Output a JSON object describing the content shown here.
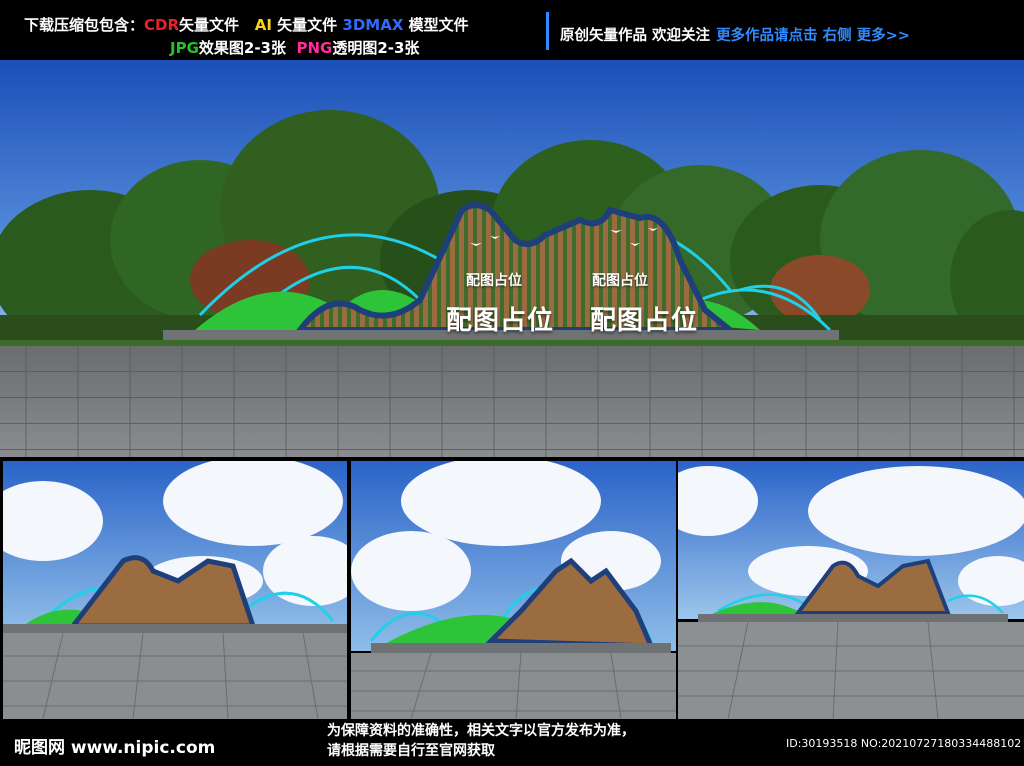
{
  "header": {
    "line1": [
      {
        "text": "下载压缩包包含：",
        "color": "white"
      },
      {
        "text": "CDR",
        "color": "red"
      },
      {
        "text": "矢量文件",
        "color": "white"
      },
      {
        "text": "AI",
        "color": "yellow"
      },
      {
        "text": "矢量文件",
        "color": "white"
      },
      {
        "text": "3DMAX",
        "color": "blue"
      },
      {
        "text": "模型文件",
        "color": "white"
      }
    ],
    "line2": [
      {
        "text": "JPG",
        "color": "green"
      },
      {
        "text": "效果图2-3张",
        "color": "white"
      },
      {
        "text": "PNG",
        "color": "pink"
      },
      {
        "text": "透明图2-3张",
        "color": "white"
      }
    ],
    "right_text": "原创矢量作品 欢迎关注",
    "right_link": "更多作品请点击 右侧 更多>>"
  },
  "sign": {
    "small_left": "配图占位",
    "small_right": "配图占位",
    "big_left": "配图占位",
    "big_right": "配图占位"
  },
  "footer": {
    "logo": "昵图网 www.nipic.com",
    "notice_line1": "为保障资料的准确性，相关文字以官方发布为准，",
    "notice_line2": "请根据需要自行至官网获取",
    "image_id": "ID:30193518 NO:20210727180334488102"
  },
  "colors": {
    "accent_red": "#e8222a",
    "accent_yellow": "#ffd21a",
    "accent_blue": "#2f6bff",
    "accent_green": "#23c32a",
    "accent_pink": "#ff2d9a",
    "link_blue": "#2f8bff",
    "hill_green": "#2ec43a",
    "frame_navy": "#1f3f7a",
    "arc_cyan": "#1fd0e8"
  }
}
